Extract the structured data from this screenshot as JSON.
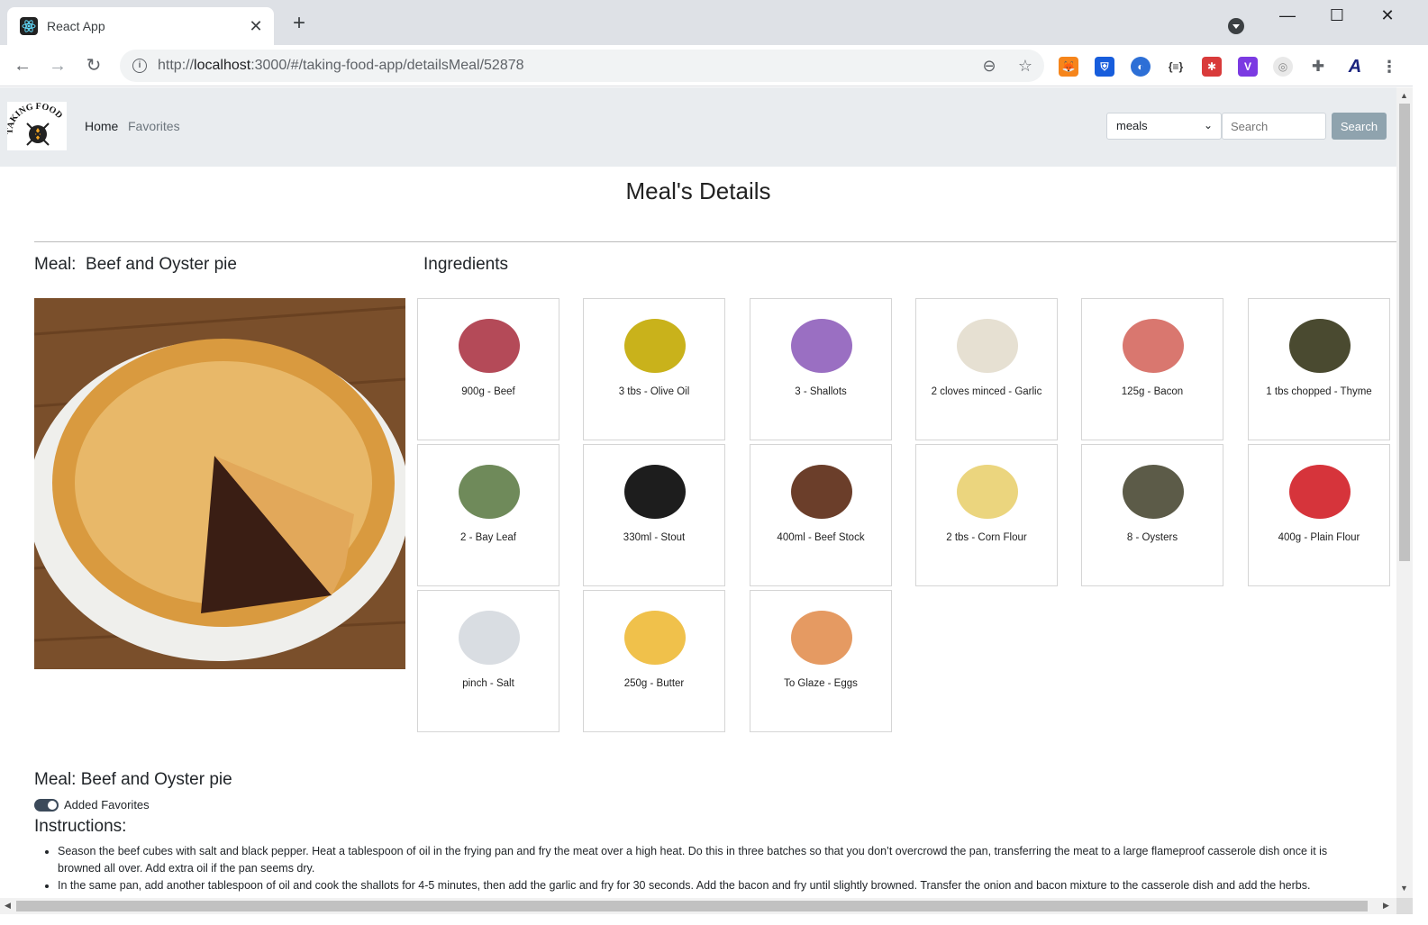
{
  "browser": {
    "tab_title": "React App",
    "url_prefix": "http://",
    "url_host": "localhost",
    "url_rest": ":3000/#/taking-food-app/detailsMeal/52878"
  },
  "navbar": {
    "home": "Home",
    "favorites": "Favorites",
    "select_value": "meals",
    "search_placeholder": "Search",
    "search_button": "Search"
  },
  "page": {
    "title": "Meal's Details",
    "meal_heading": "Meal:  Beef and Oyster pie",
    "ingredients_heading": "Ingredients",
    "meal_footer": "Meal: Beef and Oyster pie",
    "favorite_toggle_label": "Added Favorites",
    "favorite_toggle_on": true,
    "instructions_heading": "Instructions:"
  },
  "ingredients": [
    {
      "label": "900g - Beef",
      "icon": "beef-icon",
      "color": "#b44a58"
    },
    {
      "label": "3 tbs - Olive Oil",
      "icon": "olive-oil-icon",
      "color": "#c9b21b"
    },
    {
      "label": "3 - Shallots",
      "icon": "shallots-icon",
      "color": "#9a6fc2"
    },
    {
      "label": "2 cloves minced - Garlic",
      "icon": "garlic-icon",
      "color": "#e6e0d2"
    },
    {
      "label": "125g - Bacon",
      "icon": "bacon-icon",
      "color": "#d9776f"
    },
    {
      "label": "1 tbs chopped - Thyme",
      "icon": "thyme-icon",
      "color": "#4a4a30"
    },
    {
      "label": "2 - Bay Leaf",
      "icon": "bay-leaf-icon",
      "color": "#6f8a5a"
    },
    {
      "label": "330ml - Stout",
      "icon": "stout-icon",
      "color": "#1d1d1d"
    },
    {
      "label": "400ml - Beef Stock",
      "icon": "beef-stock-icon",
      "color": "#6b3e2a"
    },
    {
      "label": "2 tbs - Corn Flour",
      "icon": "corn-flour-icon",
      "color": "#ebd57e"
    },
    {
      "label": "8 - Oysters",
      "icon": "oyster-icon",
      "color": "#5c5b48"
    },
    {
      "label": "400g - Plain Flour",
      "icon": "plain-flour-icon",
      "color": "#d6343b"
    },
    {
      "label": "pinch - Salt",
      "icon": "salt-icon",
      "color": "#d9dde2"
    },
    {
      "label": "250g - Butter",
      "icon": "butter-icon",
      "color": "#f0c14b"
    },
    {
      "label": "To Glaze - Eggs",
      "icon": "egg-icon",
      "color": "#e59a62"
    }
  ],
  "instructions": [
    "Season the beef cubes with salt and black pepper. Heat a tablespoon of oil in the frying pan and fry the meat over a high heat. Do this in three batches so that you don’t overcrowd the pan, transferring the meat to a large flameproof casserole dish once it is browned all over. Add extra oil if the pan seems dry.",
    "In the same pan, add another tablespoon of oil and cook the shallots for 4-5 minutes, then add the garlic and fry for 30 seconds. Add the bacon and fry until slightly browned. Transfer the onion and bacon mixture to the casserole dish and add the herbs."
  ]
}
